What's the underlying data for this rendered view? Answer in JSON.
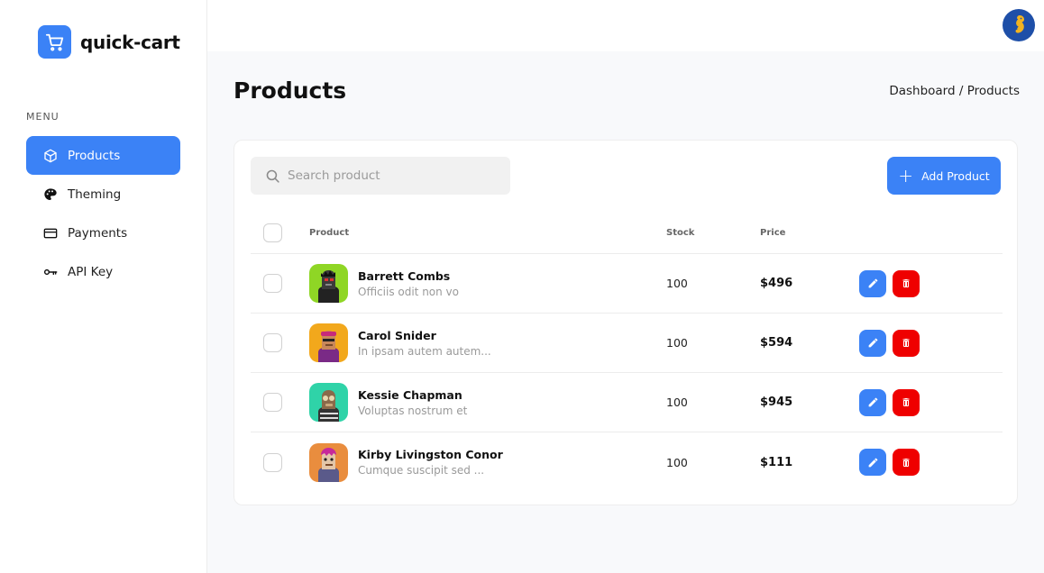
{
  "app": {
    "name": "quick-cart"
  },
  "sidebar": {
    "menu_label": "MENU",
    "items": [
      {
        "label": "Products",
        "icon": "box-icon",
        "active": true
      },
      {
        "label": "Theming",
        "icon": "palette-icon",
        "active": false
      },
      {
        "label": "Payments",
        "icon": "credit-card-icon",
        "active": false
      },
      {
        "label": "API Key",
        "icon": "key-icon",
        "active": false
      }
    ]
  },
  "header": {
    "title": "Products",
    "breadcrumb": "Dashboard / Products"
  },
  "toolbar": {
    "search_placeholder": "Search product",
    "add_label": "Add Product"
  },
  "table": {
    "columns": {
      "product": "Product",
      "stock": "Stock",
      "price": "Price"
    },
    "rows": [
      {
        "name": "Barrett Combs",
        "description": "Officiis odit non vo",
        "stock": "100",
        "price": "$496",
        "thumb_color": "#8fd625"
      },
      {
        "name": "Carol Snider",
        "description": "In ipsam autem autem...",
        "stock": "100",
        "price": "$594",
        "thumb_color": "#f2a81c"
      },
      {
        "name": "Kessie Chapman",
        "description": "Voluptas nostrum et",
        "stock": "100",
        "price": "$945",
        "thumb_color": "#2fd3a8"
      },
      {
        "name": "Kirby Livingston Conor",
        "description": "Cumque suscipit sed ...",
        "stock": "100",
        "price": "$111",
        "thumb_color": "#e98d3e"
      }
    ]
  },
  "colors": {
    "accent": "#3b82f6",
    "danger": "#ef0000"
  }
}
